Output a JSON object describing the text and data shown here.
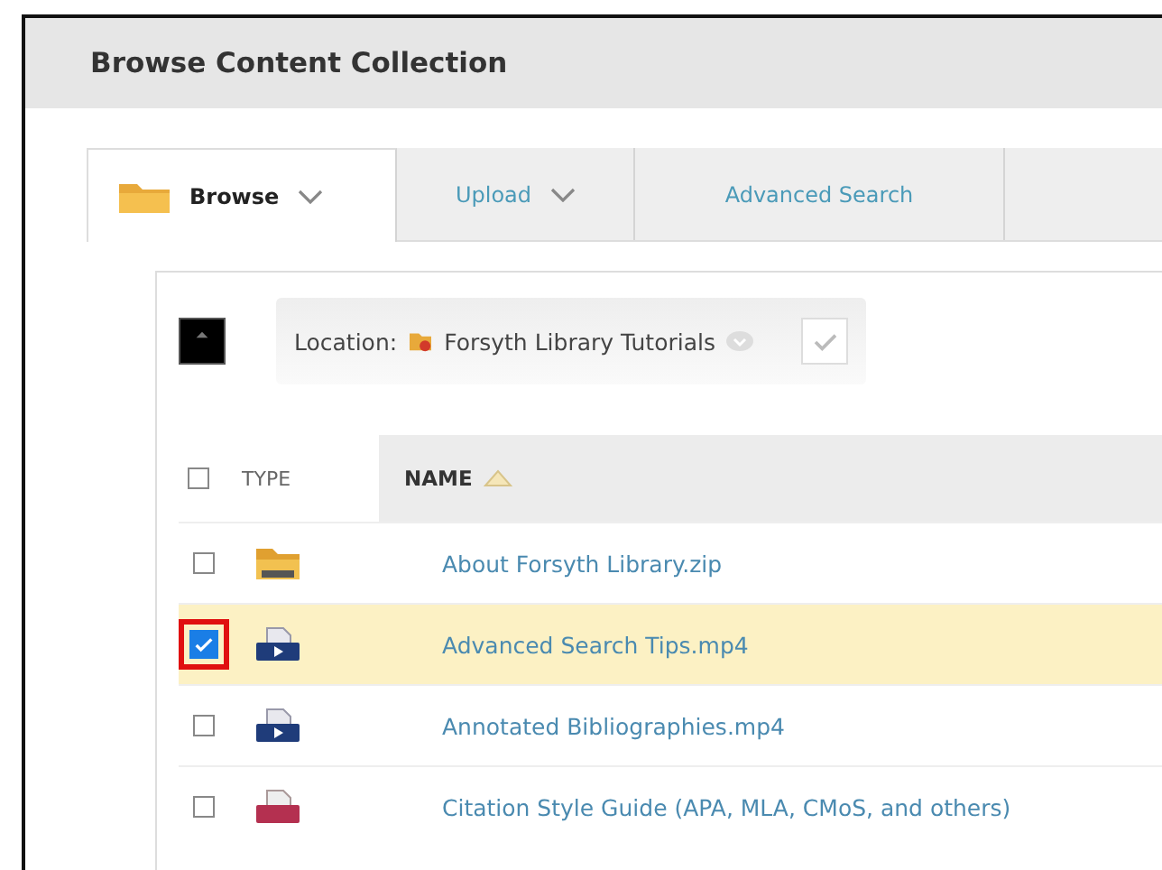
{
  "window": {
    "title": "Browse Content Collection"
  },
  "tabs": [
    {
      "label": "Browse",
      "selected": true,
      "icon": true,
      "dropdown": true
    },
    {
      "label": "Upload",
      "selected": false,
      "icon": false,
      "dropdown": true
    },
    {
      "label": "Advanced Search",
      "selected": false,
      "icon": false,
      "dropdown": false
    }
  ],
  "location": {
    "label": "Location:",
    "value": "Forsyth Library Tutorials"
  },
  "table": {
    "columns": [
      "TYPE",
      "NAME"
    ],
    "all_checked": false,
    "rows": [
      {
        "kind": "archive",
        "name": "About Forsyth Library.zip",
        "checked": false,
        "selected": false,
        "highlighted": false
      },
      {
        "kind": "video",
        "name": "Advanced Search Tips.mp4",
        "checked": true,
        "selected": true,
        "highlighted": true
      },
      {
        "kind": "video",
        "name": "Annotated Bibliographies.mp4",
        "checked": false,
        "selected": false,
        "highlighted": false
      },
      {
        "kind": "document",
        "name": "Citation Style Guide (APA, MLA, CMoS, and others)",
        "checked": false,
        "selected": false,
        "highlighted": false
      }
    ]
  }
}
